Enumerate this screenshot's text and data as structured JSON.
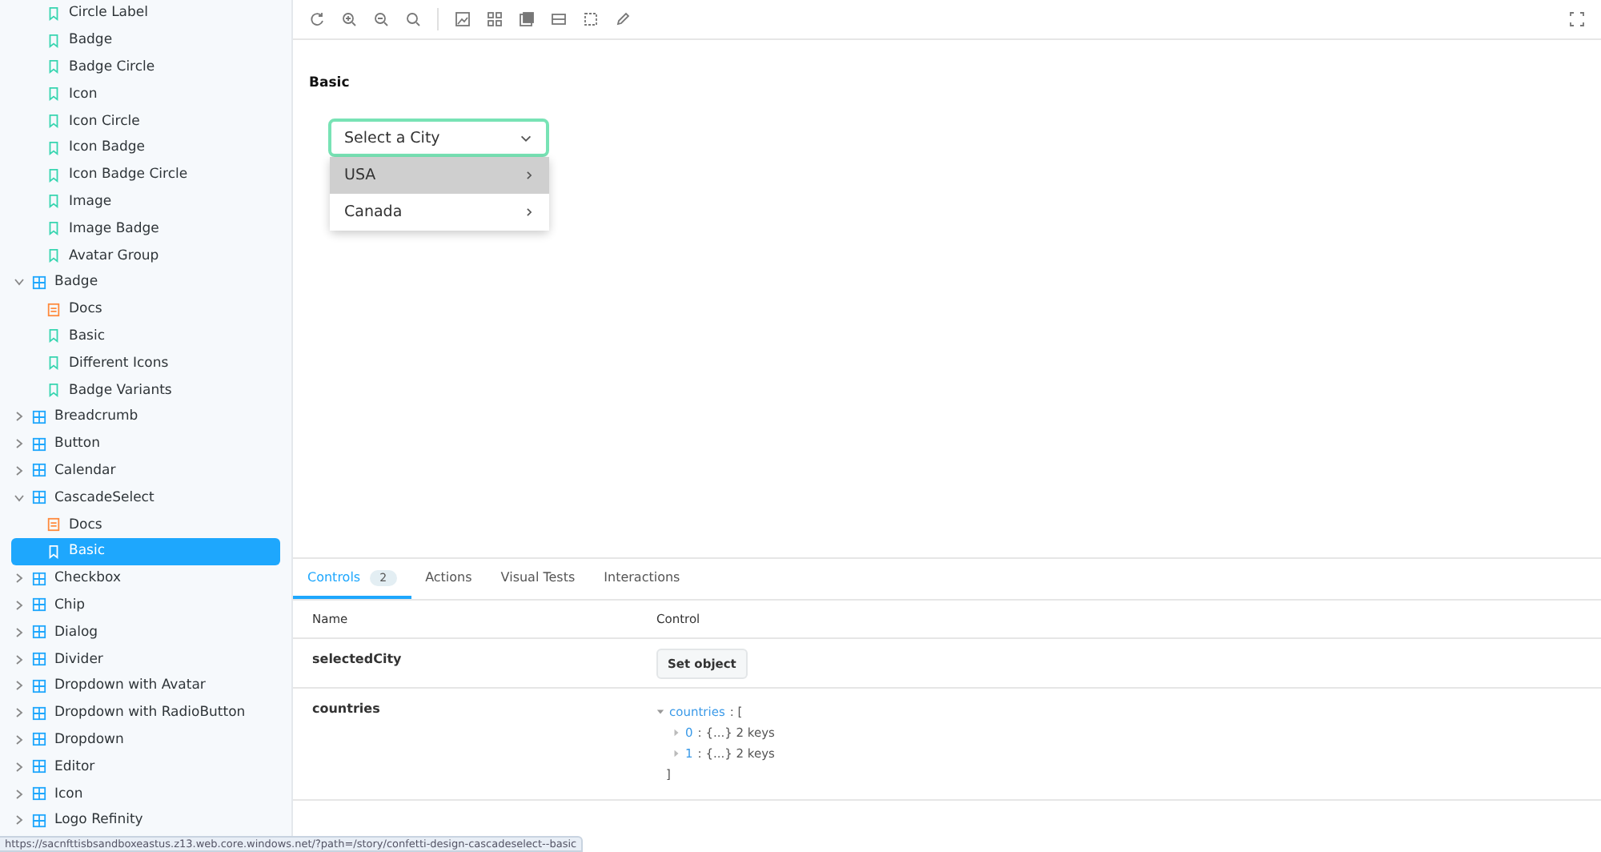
{
  "sidebar": {
    "items": [
      {
        "label": "Circle Label",
        "kind": "story",
        "selected": false
      },
      {
        "label": "Badge",
        "kind": "story",
        "selected": false
      },
      {
        "label": "Badge Circle",
        "kind": "story",
        "selected": false
      },
      {
        "label": "Icon",
        "kind": "story",
        "selected": false
      },
      {
        "label": "Icon Circle",
        "kind": "story",
        "selected": false
      },
      {
        "label": "Icon Badge",
        "kind": "story",
        "selected": false
      },
      {
        "label": "Icon Badge Circle",
        "kind": "story",
        "selected": false
      },
      {
        "label": "Image",
        "kind": "story",
        "selected": false
      },
      {
        "label": "Image Badge",
        "kind": "story",
        "selected": false
      },
      {
        "label": "Avatar Group",
        "kind": "story",
        "selected": false
      },
      {
        "label": "Badge",
        "kind": "component",
        "expanded": true,
        "children": [
          {
            "label": "Docs",
            "kind": "docs",
            "selected": false
          },
          {
            "label": "Basic",
            "kind": "story",
            "selected": false
          },
          {
            "label": "Different Icons",
            "kind": "story",
            "selected": false
          },
          {
            "label": "Badge Variants",
            "kind": "story",
            "selected": false
          }
        ]
      },
      {
        "label": "Breadcrumb",
        "kind": "component",
        "expanded": false
      },
      {
        "label": "Button",
        "kind": "component",
        "expanded": false
      },
      {
        "label": "Calendar",
        "kind": "component",
        "expanded": false
      },
      {
        "label": "CascadeSelect",
        "kind": "component",
        "expanded": true,
        "children": [
          {
            "label": "Docs",
            "kind": "docs",
            "selected": false
          },
          {
            "label": "Basic",
            "kind": "story",
            "selected": true
          }
        ]
      },
      {
        "label": "Checkbox",
        "kind": "component",
        "expanded": false
      },
      {
        "label": "Chip",
        "kind": "component",
        "expanded": false
      },
      {
        "label": "Dialog",
        "kind": "component",
        "expanded": false
      },
      {
        "label": "Divider",
        "kind": "component",
        "expanded": false
      },
      {
        "label": "Dropdown with Avatar",
        "kind": "component",
        "expanded": false
      },
      {
        "label": "Dropdown with RadioButton",
        "kind": "component",
        "expanded": false
      },
      {
        "label": "Dropdown",
        "kind": "component",
        "expanded": false
      },
      {
        "label": "Editor",
        "kind": "component",
        "expanded": false
      },
      {
        "label": "Icon",
        "kind": "component",
        "expanded": false
      },
      {
        "label": "Logo Refinity",
        "kind": "component",
        "expanded": false
      }
    ]
  },
  "canvas": {
    "title": "Basic",
    "select": {
      "placeholder": "Select a City",
      "options": [
        {
          "label": "USA",
          "selected": true
        },
        {
          "label": "Canada",
          "selected": false
        }
      ]
    }
  },
  "addons": {
    "tabs": [
      {
        "label": "Controls",
        "badge": "2",
        "selected": true
      },
      {
        "label": "Actions",
        "selected": false
      },
      {
        "label": "Visual Tests",
        "selected": false
      },
      {
        "label": "Interactions",
        "selected": false
      }
    ],
    "columns": [
      "Name",
      "Control"
    ],
    "rows": [
      {
        "name": "selectedCity",
        "kind": "button",
        "button": "Set object"
      },
      {
        "name": "countries",
        "kind": "object",
        "key": "countries",
        "open": ": [",
        "entries": [
          {
            "index": "0",
            "summary": ": {...} 2 keys"
          },
          {
            "index": "1",
            "summary": ": {...} 2 keys"
          }
        ],
        "close": "]"
      }
    ]
  },
  "status_bar": {
    "url": "https://sacnfttisbsandboxeastus.z13.web.core.windows.net/?path=/story/confetti-design-cascadeselect--basic"
  }
}
